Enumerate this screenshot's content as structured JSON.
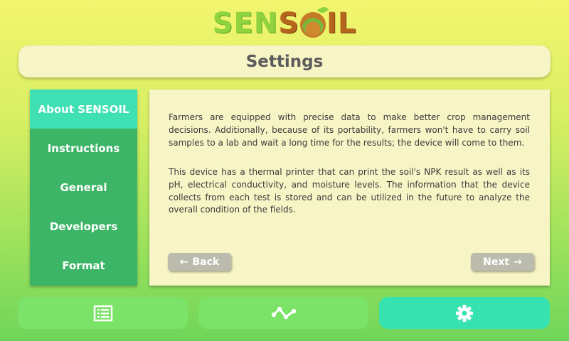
{
  "logo": {
    "part1": "SEN",
    "part2": "S",
    "part3": "IL"
  },
  "header": {
    "title": "Settings"
  },
  "sidebar": {
    "items": [
      {
        "label": "About SENSOIL",
        "active": true
      },
      {
        "label": "Instructions"
      },
      {
        "label": "General"
      },
      {
        "label": "Developers"
      },
      {
        "label": "Format"
      }
    ]
  },
  "content": {
    "paragraph1": "Farmers are equipped with precise data to make better crop management decisions. Additionally, because of its portability, farmers won't have to carry soil samples to a lab and wait a long time for the results; the device will come to them.",
    "paragraph2": "This device has a thermal printer that can print the soil's NPK result as well as its pH, electrical conductivity, and moisture levels. The information that the device collects from each test is stored and can be utilized in the future to analyze the overall condition of the fields.",
    "back_label": "Back",
    "next_label": "Next",
    "back_arrow": "←",
    "next_arrow": "→"
  },
  "bottom_nav": {
    "icons": [
      "list-icon",
      "chart-line-icon",
      "gear-icon"
    ],
    "active": "gear-icon"
  },
  "colors": {
    "sidebar": "#3db567",
    "sidebar_active": "#3ee0b4",
    "panel": "#f7f4c6",
    "button_green": "#7be367",
    "button_active": "#36e2b0",
    "nav_button": "#bcbcae"
  }
}
